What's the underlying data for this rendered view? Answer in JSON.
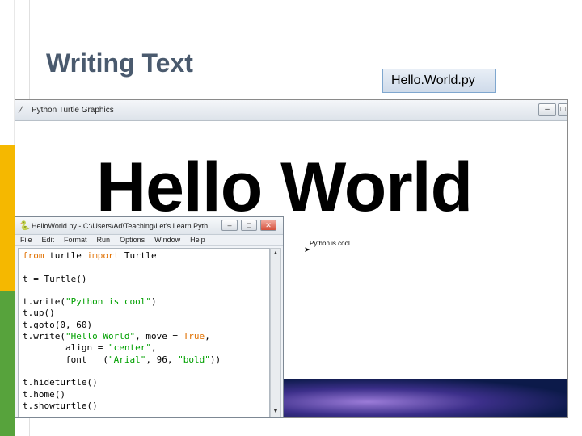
{
  "slide": {
    "title": "Writing Text",
    "file_label": "Hello.World.py"
  },
  "turtle_window": {
    "title": "Python Turtle Graphics",
    "minimize": "–",
    "maximize": "□",
    "canvas_big_text": "Hello World",
    "canvas_small_text": "Python is cool",
    "turtle_glyph": "➤"
  },
  "editor_window": {
    "title": "HelloWorld.py - C:\\Users\\Ad\\Teaching\\Let's Learn Pyth...",
    "minimize": "–",
    "maximize": "□",
    "close": "✕",
    "menu": [
      "File",
      "Edit",
      "Format",
      "Run",
      "Options",
      "Window",
      "Help"
    ],
    "code_lines": [
      [
        {
          "t": "from",
          "c": "kw"
        },
        {
          "t": " turtle ",
          "c": ""
        },
        {
          "t": "import",
          "c": "kw"
        },
        {
          "t": " Turtle",
          "c": ""
        }
      ],
      [],
      [
        {
          "t": "t = Turtle()",
          "c": ""
        }
      ],
      [],
      [
        {
          "t": "t.write(",
          "c": ""
        },
        {
          "t": "\"Python is cool\"",
          "c": "str"
        },
        {
          "t": ")",
          "c": ""
        }
      ],
      [
        {
          "t": "t.up()",
          "c": ""
        }
      ],
      [
        {
          "t": "t.goto(0, 60)",
          "c": ""
        }
      ],
      [
        {
          "t": "t.write(",
          "c": ""
        },
        {
          "t": "\"Hello World\"",
          "c": "str"
        },
        {
          "t": ", move = ",
          "c": ""
        },
        {
          "t": "True",
          "c": "kw"
        },
        {
          "t": ",",
          "c": ""
        }
      ],
      [
        {
          "t": "        align = ",
          "c": ""
        },
        {
          "t": "\"center\"",
          "c": "str"
        },
        {
          "t": ",",
          "c": ""
        }
      ],
      [
        {
          "t": "        font   (",
          "c": ""
        },
        {
          "t": "\"Arial\"",
          "c": "str"
        },
        {
          "t": ", 96, ",
          "c": ""
        },
        {
          "t": "\"bold\"",
          "c": "str"
        },
        {
          "t": "))",
          "c": ""
        }
      ],
      [],
      [
        {
          "t": "t.hideturtle()",
          "c": ""
        }
      ],
      [
        {
          "t": "t.home()",
          "c": ""
        }
      ],
      [
        {
          "t": "t.showturtle()",
          "c": ""
        }
      ]
    ],
    "scroll_up": "▲",
    "scroll_down": "▼"
  },
  "colors": {
    "title_text": "#4a5a6e",
    "keyword": "#e07000",
    "string": "#00a000",
    "bar_blue": "#1e73be",
    "bar_yellow": "#f5b800",
    "bar_green": "#57a33c"
  }
}
